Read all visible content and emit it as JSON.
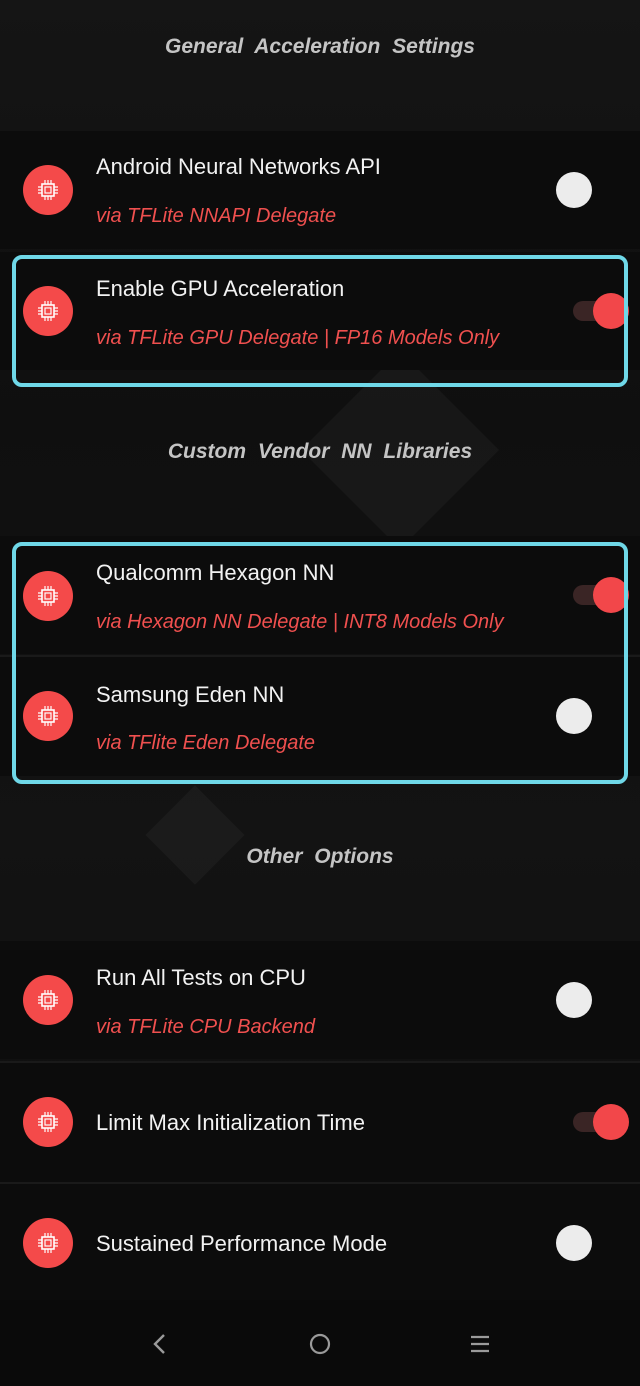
{
  "sections": {
    "general": "General  Acceleration  Settings",
    "vendor": "Custom  Vendor  NN  Libraries",
    "other": "Other  Options"
  },
  "rows": [
    {
      "title": "Android Neural Networks API",
      "subtitle": "via TFLite NNAPI Delegate",
      "enabled": false
    },
    {
      "title": "Enable GPU Acceleration",
      "subtitle": "via TFLite GPU Delegate  |  FP16 Models Only",
      "enabled": true
    },
    {
      "title": "Qualcomm Hexagon NN",
      "subtitle": "via Hexagon NN Delegate  |  INT8 Models Only",
      "enabled": true
    },
    {
      "title": "Samsung Eden NN",
      "subtitle": "via TFlite Eden Delegate",
      "enabled": false
    },
    {
      "title": "Run All Tests on CPU",
      "subtitle": "via TFLite CPU Backend",
      "enabled": false
    },
    {
      "title": "Limit Max Initialization Time",
      "enabled": true
    },
    {
      "title": "Sustained Performance Mode",
      "enabled": false
    }
  ],
  "icons": {
    "row_icon": "chip-icon",
    "nav_back": "back-chevron-icon",
    "nav_home": "home-circle-icon",
    "nav_menu": "menu-lines-icon"
  },
  "colors": {
    "accent": "#f44a4a",
    "highlight": "#6fd8e8"
  }
}
